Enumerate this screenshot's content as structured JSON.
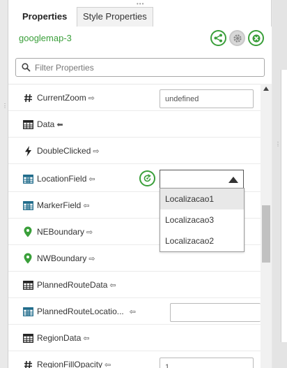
{
  "tabs": [
    {
      "label": "Properties",
      "active": true
    },
    {
      "label": "Style Properties",
      "active": false
    }
  ],
  "component": {
    "name": "googlemap-3"
  },
  "filter": {
    "placeholder": "Filter Properties",
    "value": ""
  },
  "properties": [
    {
      "icon": "hash-icon",
      "name": "CurrentZoom",
      "arrow": "⇨",
      "value": "undefined"
    },
    {
      "icon": "table-icon",
      "name": "Data",
      "arrow": "⬅"
    },
    {
      "icon": "lightning-icon",
      "name": "DoubleClicked",
      "arrow": "⇨"
    },
    {
      "icon": "table-column-icon",
      "name": "LocationField",
      "arrow": "⇦"
    },
    {
      "icon": "table-column-icon",
      "name": "MarkerField",
      "arrow": "⇦"
    },
    {
      "icon": "map-pin-icon",
      "name": "NEBoundary",
      "arrow": "⇨"
    },
    {
      "icon": "map-pin-icon",
      "name": "NWBoundary",
      "arrow": "⇨"
    },
    {
      "icon": "table-icon",
      "name": "PlannedRouteData",
      "arrow": "⇦"
    },
    {
      "icon": "table-column-icon",
      "name": "PlannedRouteLocatio...",
      "arrow": "⇦",
      "value": ""
    },
    {
      "icon": "table-icon",
      "name": "RegionData",
      "arrow": "⇦"
    },
    {
      "icon": "hash-icon",
      "name": "RegionFillOpacity",
      "arrow": "⇦",
      "value": "1"
    }
  ],
  "location_field_select": {
    "value": ""
  },
  "dropdown_options": [
    "Localizacao1",
    "Localizacao3",
    "Localizacao2"
  ],
  "colors": {
    "accent": "#3a9f3a"
  }
}
